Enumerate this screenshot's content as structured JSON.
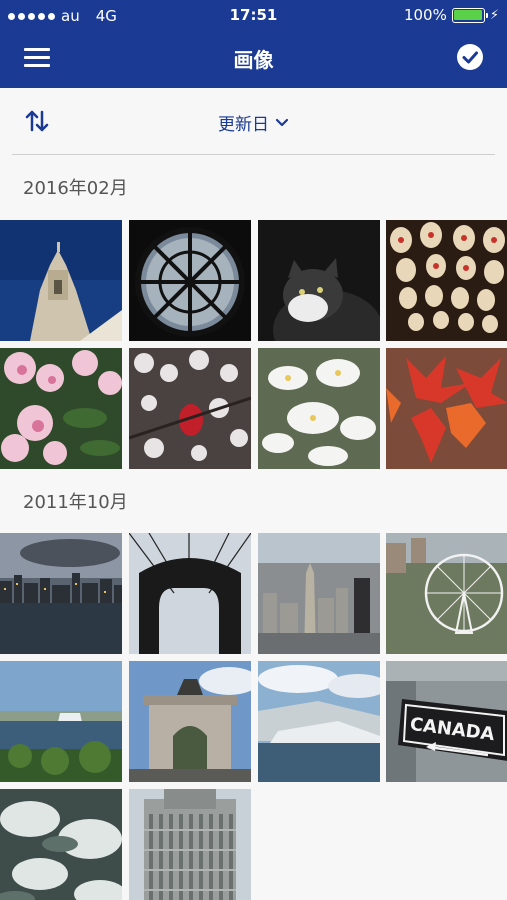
{
  "status_bar": {
    "carrier": "au",
    "network": "4G",
    "time": "17:51",
    "battery": "100%"
  },
  "nav": {
    "title": "画像"
  },
  "toolbar": {
    "sort_label": "更新日"
  },
  "sections": [
    {
      "label": "2016年02月",
      "photos": [
        {
          "name": "church-tower-photo"
        },
        {
          "name": "clock-window-photo"
        },
        {
          "name": "cat-photo"
        },
        {
          "name": "lanterns-photo"
        },
        {
          "name": "pink-azalea-photo"
        },
        {
          "name": "white-blossom-red-flower-photo"
        },
        {
          "name": "white-flowers-photo"
        },
        {
          "name": "red-maple-leaves-photo"
        }
      ]
    },
    {
      "label": "2011年10月",
      "photos": [
        {
          "name": "city-skyline-photo"
        },
        {
          "name": "brooklyn-bridge-photo"
        },
        {
          "name": "aerial-city-photo"
        },
        {
          "name": "ferris-wheel-photo"
        },
        {
          "name": "niagara-falls-photo"
        },
        {
          "name": "memorial-arch-photo"
        },
        {
          "name": "waterfall-mist-photo"
        },
        {
          "name": "canada-sign-photo"
        },
        {
          "name": "rapids-photo"
        },
        {
          "name": "skyscraper-photo"
        }
      ]
    }
  ],
  "sign_text": "CANADA",
  "colors": {
    "header": "#1b3a93",
    "accent": "#1b3a93",
    "battery": "#5bd14a"
  }
}
